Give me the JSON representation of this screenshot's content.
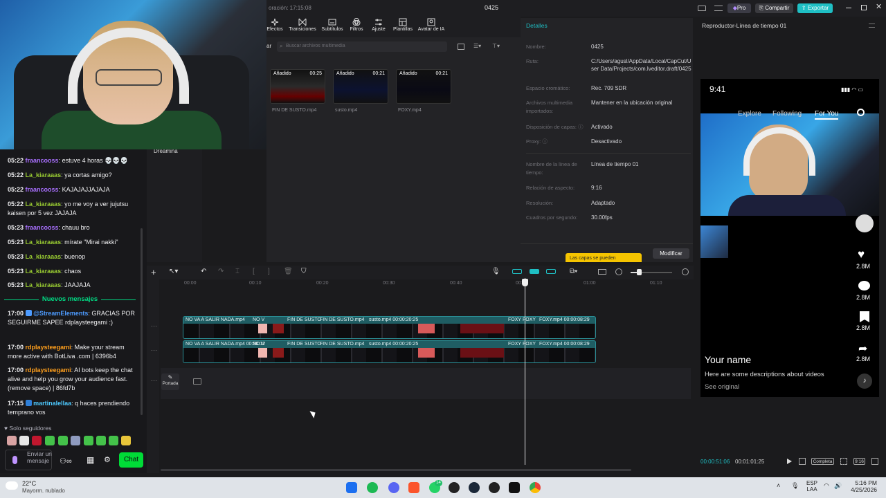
{
  "window": {
    "title": "0425",
    "autosave": "oración: 17:15:08",
    "pro_label": "Pro",
    "share_label": "Compartir",
    "export_label": "Exportar"
  },
  "toolbar": {
    "tools": [
      "Efectos",
      "Transiciones",
      "Subtítulos",
      "Filtros",
      "Ajuste",
      "Plantillas",
      "Avatar de IA"
    ]
  },
  "media": {
    "import_fragment": "ar",
    "search_placeholder": "Buscar archivos multimedia",
    "sidebar_item": "Dreamina",
    "clips": [
      {
        "badge": "Añadido",
        "duration": "00:25",
        "name": "FIN DE SUSTO.mp4"
      },
      {
        "badge": "Añadido",
        "duration": "00:21",
        "name": "susto.mp4"
      },
      {
        "badge": "Añadido",
        "duration": "00:21",
        "name": "FOXY.mp4"
      }
    ]
  },
  "details": {
    "title": "Detalles",
    "rows": [
      {
        "key": "Nombre:",
        "value": "0425"
      },
      {
        "key": "Ruta:",
        "value": "C:/Users/agusl/AppData/Local/CapCut/User Data/Projects/com.lveditor.draft/0425"
      },
      {
        "key": "Espacio cromático:",
        "value": "Rec. 709 SDR"
      },
      {
        "key": "Archivos multimedia importados:",
        "value": "Mantener en la ubicación original"
      },
      {
        "key": "Disposición de capas:",
        "value": "Activado"
      },
      {
        "key": "Proxy:",
        "value": "Desactivado"
      },
      {
        "key": "Nombre de la línea de tiempo:",
        "value": "Línea de tiempo 01"
      },
      {
        "key": "Relación de aspecto:",
        "value": "9:16"
      },
      {
        "key": "Resolución:",
        "value": "Adaptado"
      },
      {
        "key": "Cuadros por segundo:",
        "value": "30.00fps"
      }
    ],
    "tooltip": "Las capas se pueden",
    "modify_label": "Modificar"
  },
  "player": {
    "title": "Reproductor-Línea de tiempo 01",
    "status_time": "9:41",
    "feed_tabs": [
      "Explore",
      "Following",
      "For You"
    ],
    "counts": [
      "2.8M",
      "2.8M",
      "2.8M",
      "2.8M"
    ],
    "username": "Your name",
    "description": "Here are some descriptions about videos",
    "see_original": "See original",
    "current_time": "00:00:51:06",
    "total_time": "00:01:01:25",
    "quality_label": "Completa",
    "ratio_label": "9:16"
  },
  "timeline": {
    "ruler": [
      "00:00",
      "00:10",
      "00:20",
      "00:30",
      "00:40",
      "00:50",
      "01:00",
      "01:10"
    ],
    "track1_labels": [
      "NO VA A SALIR NADA.mp4",
      "NO V",
      "FIN DE SUSTO",
      "FIN DE SUSTO.mp4",
      "susto.mp4  00:00:20:25",
      "FOXY",
      "FOXY",
      "FOXY.mp4  00:00:08:29"
    ],
    "track2_labels": [
      "NO VA A SALIR NADA.mp4  00:00:12",
      "NO V",
      "FIN DE SUSTO",
      "FIN DE SUSTO.mp4",
      "susto.mp4  00:00:20:25",
      "FOXY",
      "FOXY",
      "FOXY.mp4  00:00:08:29"
    ],
    "cover_label": "Portada"
  },
  "chat": {
    "messages": [
      {
        "time": "05:22",
        "user": "fraancooss",
        "color": "#a970ff",
        "text": "estuve 4 horas 💀💀💀"
      },
      {
        "time": "05:22",
        "user": "La_kiaraaas",
        "color": "#9ACD32",
        "text": "ya cortas amigo?"
      },
      {
        "time": "05:22",
        "user": "fraancooss",
        "color": "#a970ff",
        "text": "KAJAJAJJAJAJA"
      },
      {
        "time": "05:22",
        "user": "La_kiaraaas",
        "color": "#9ACD32",
        "text": "yo me voy a ver jujutsu kaisen por 5 vez JAJAJA"
      },
      {
        "time": "05:23",
        "user": "fraancooss",
        "color": "#a970ff",
        "text": "chauu bro"
      },
      {
        "time": "05:23",
        "user": "La_kiaraaas",
        "color": "#9ACD32",
        "text": "mírate \"Mirai nakki\""
      },
      {
        "time": "05:23",
        "user": "La_kiaraaas",
        "color": "#9ACD32",
        "text": "buenop"
      },
      {
        "time": "05:23",
        "user": "La_kiaraaas",
        "color": "#9ACD32",
        "text": "chaos"
      },
      {
        "time": "05:23",
        "user": "La_kiaraaas",
        "color": "#9ACD32",
        "text": "JAAJAJA"
      }
    ],
    "divider": "Nuevos mensajes",
    "new_messages": [
      {
        "time": "17:00",
        "user": "@StreamElements",
        "color": "#4d9bff",
        "text": "GRACIAS POR SEGUIRME SAPEE rdplaysteegami :)"
      },
      {
        "time": "17:00",
        "user": "rdplaysteegami",
        "color": "#ff9f1c",
        "text": "Make your stream more active with BotLiva .com | 6396b4"
      },
      {
        "time": "17:00",
        "user": "rdplaysteegami",
        "color": "#ff9f1c",
        "text": "AI bots keep the chat alive and help you grow your audience fast. (remove space) | 86fd7b"
      },
      {
        "time": "17:15",
        "user": "martinalellaa",
        "color": "#4dc9ff",
        "text": "q haces prendiendo temprano vos"
      }
    ],
    "followers_only": "Solo seguidores",
    "input_placeholder": "Enviar un mensaje",
    "chat_button": "Chat"
  },
  "taskbar": {
    "weather_temp": "22°C",
    "weather_desc": "Mayorm. nublado",
    "lang1": "ESP",
    "lang2": "LAA",
    "clock_time": "5:16 PM",
    "clock_date": "4/25/2026",
    "badge_count": "14"
  }
}
